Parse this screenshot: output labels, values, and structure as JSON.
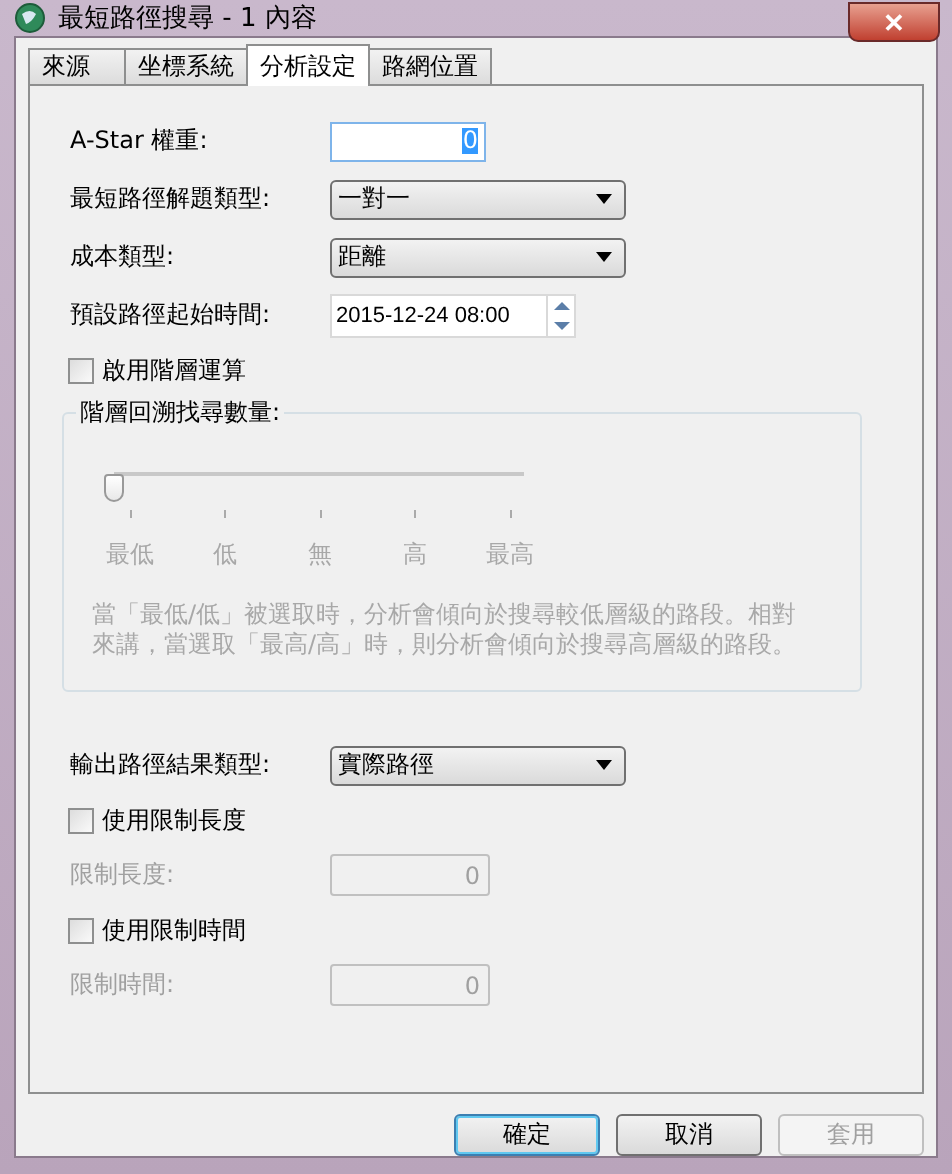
{
  "window": {
    "title": "最短路徑搜尋 - 1  內容",
    "close": "✕"
  },
  "tabs": [
    {
      "label": "來源",
      "selected": false
    },
    {
      "label": "坐標系統",
      "selected": false
    },
    {
      "label": "分析設定",
      "selected": true
    },
    {
      "label": "路網位置",
      "selected": false
    }
  ],
  "fields": [
    {
      "kind": "number",
      "label": "A-Star 權重:",
      "value": "0"
    },
    {
      "kind": "dropdown",
      "label": "最短路徑解題類型:",
      "value": "一對一"
    },
    {
      "kind": "dropdown",
      "label": "成本類型:",
      "value": "距離"
    },
    {
      "kind": "datetime",
      "label": "預設路徑起始時間:",
      "value": "2015-12-24 08:00"
    }
  ],
  "hierarchy_checkbox": {
    "label": "啟用階層運算",
    "checked": false
  },
  "hierarchy_group": {
    "title": "階層回溯找尋數量:",
    "disabled": true,
    "slider": {
      "level": 0,
      "ticks": [
        "最低",
        "低",
        "無",
        "高",
        "最高"
      ]
    },
    "description": "當「最低/低」被選取時，分析會傾向於搜尋較低層級的路段。相對來講，當選取「最高/高」時，則分析會傾向於搜尋高層級的路段。"
  },
  "output_field": {
    "kind": "dropdown",
    "label": "輸出路徑結果類型:",
    "value": "實際路徑"
  },
  "limits": [
    {
      "checkbox": "使用限制長度",
      "checked": false,
      "label": "限制長度:",
      "value": "0",
      "disabled": true
    },
    {
      "checkbox": "使用限制時間",
      "checked": false,
      "label": "限制時間:",
      "value": "0",
      "disabled": true
    }
  ],
  "buttons": [
    {
      "label": "確定",
      "disabled": false,
      "default": true
    },
    {
      "label": "取消",
      "disabled": false,
      "default": false
    },
    {
      "label": "套用",
      "disabled": true,
      "default": false
    }
  ]
}
